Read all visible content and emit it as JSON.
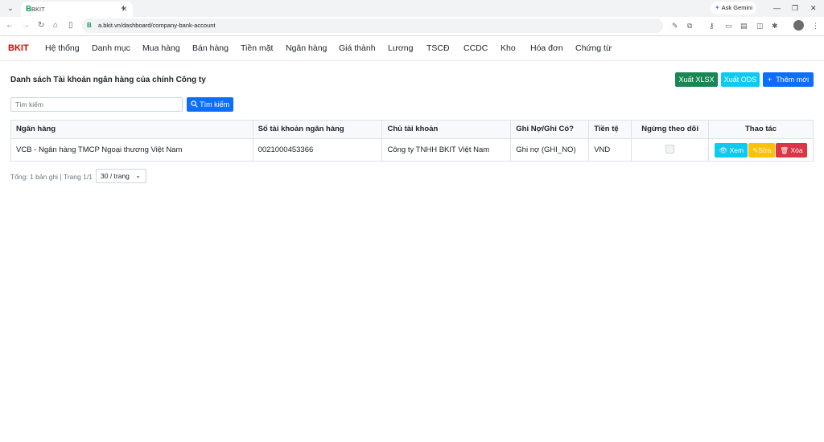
{
  "browser": {
    "tab_title": "BKIT",
    "tab_favicon": "B",
    "url": "a.bkit.vn/dashboard/company-bank-account",
    "gemini_label": "Ask Gemini"
  },
  "app": {
    "brand": "BKIT",
    "menu": [
      "Hệ thống",
      "Danh mục",
      "Mua hàng",
      "Bán hàng",
      "Tiền mặt",
      "Ngân hàng",
      "Giá thành",
      "Lương",
      "TSCĐ",
      "CCDC",
      "Kho",
      "Hóa đơn",
      "Chứng từ"
    ]
  },
  "page": {
    "title": "Danh sách Tài khoản ngân hàng của chính Công ty",
    "export_xlsx": "Xuất XLSX",
    "export_ods": "Xuất ODS",
    "add_new": "Thêm mới",
    "search_placeholder": "Tìm kiếm",
    "search_button": "Tìm kiếm"
  },
  "table": {
    "columns": [
      "Ngân hàng",
      "Số tài khoản ngân hàng",
      "Chủ tài khoản",
      "Ghi Nợ/Ghi Có?",
      "Tiền tệ",
      "Ngừng theo dõi",
      "Thao tác"
    ],
    "rows": [
      {
        "bank": "VCB - Ngân hàng TMCP Ngoại thương Việt Nam",
        "account_number": "0021000453366",
        "owner": "Công ty TNHH BKIT Việt Nam",
        "debit_credit": "Ghi nợ (GHI_NO)",
        "currency": "VND",
        "inactive": false
      }
    ],
    "actions": {
      "view": "Xem",
      "edit": "Sửa",
      "delete": "Xóa"
    }
  },
  "footer": {
    "summary": "Tổng: 1 bản ghi | Trang 1/1",
    "page_size": "30 / trang"
  },
  "colors": {
    "brand": "#e00000",
    "success": "#198754",
    "info": "#0dcaf0",
    "primary": "#0d6efd",
    "warning": "#ffc107",
    "danger": "#dc3545"
  }
}
